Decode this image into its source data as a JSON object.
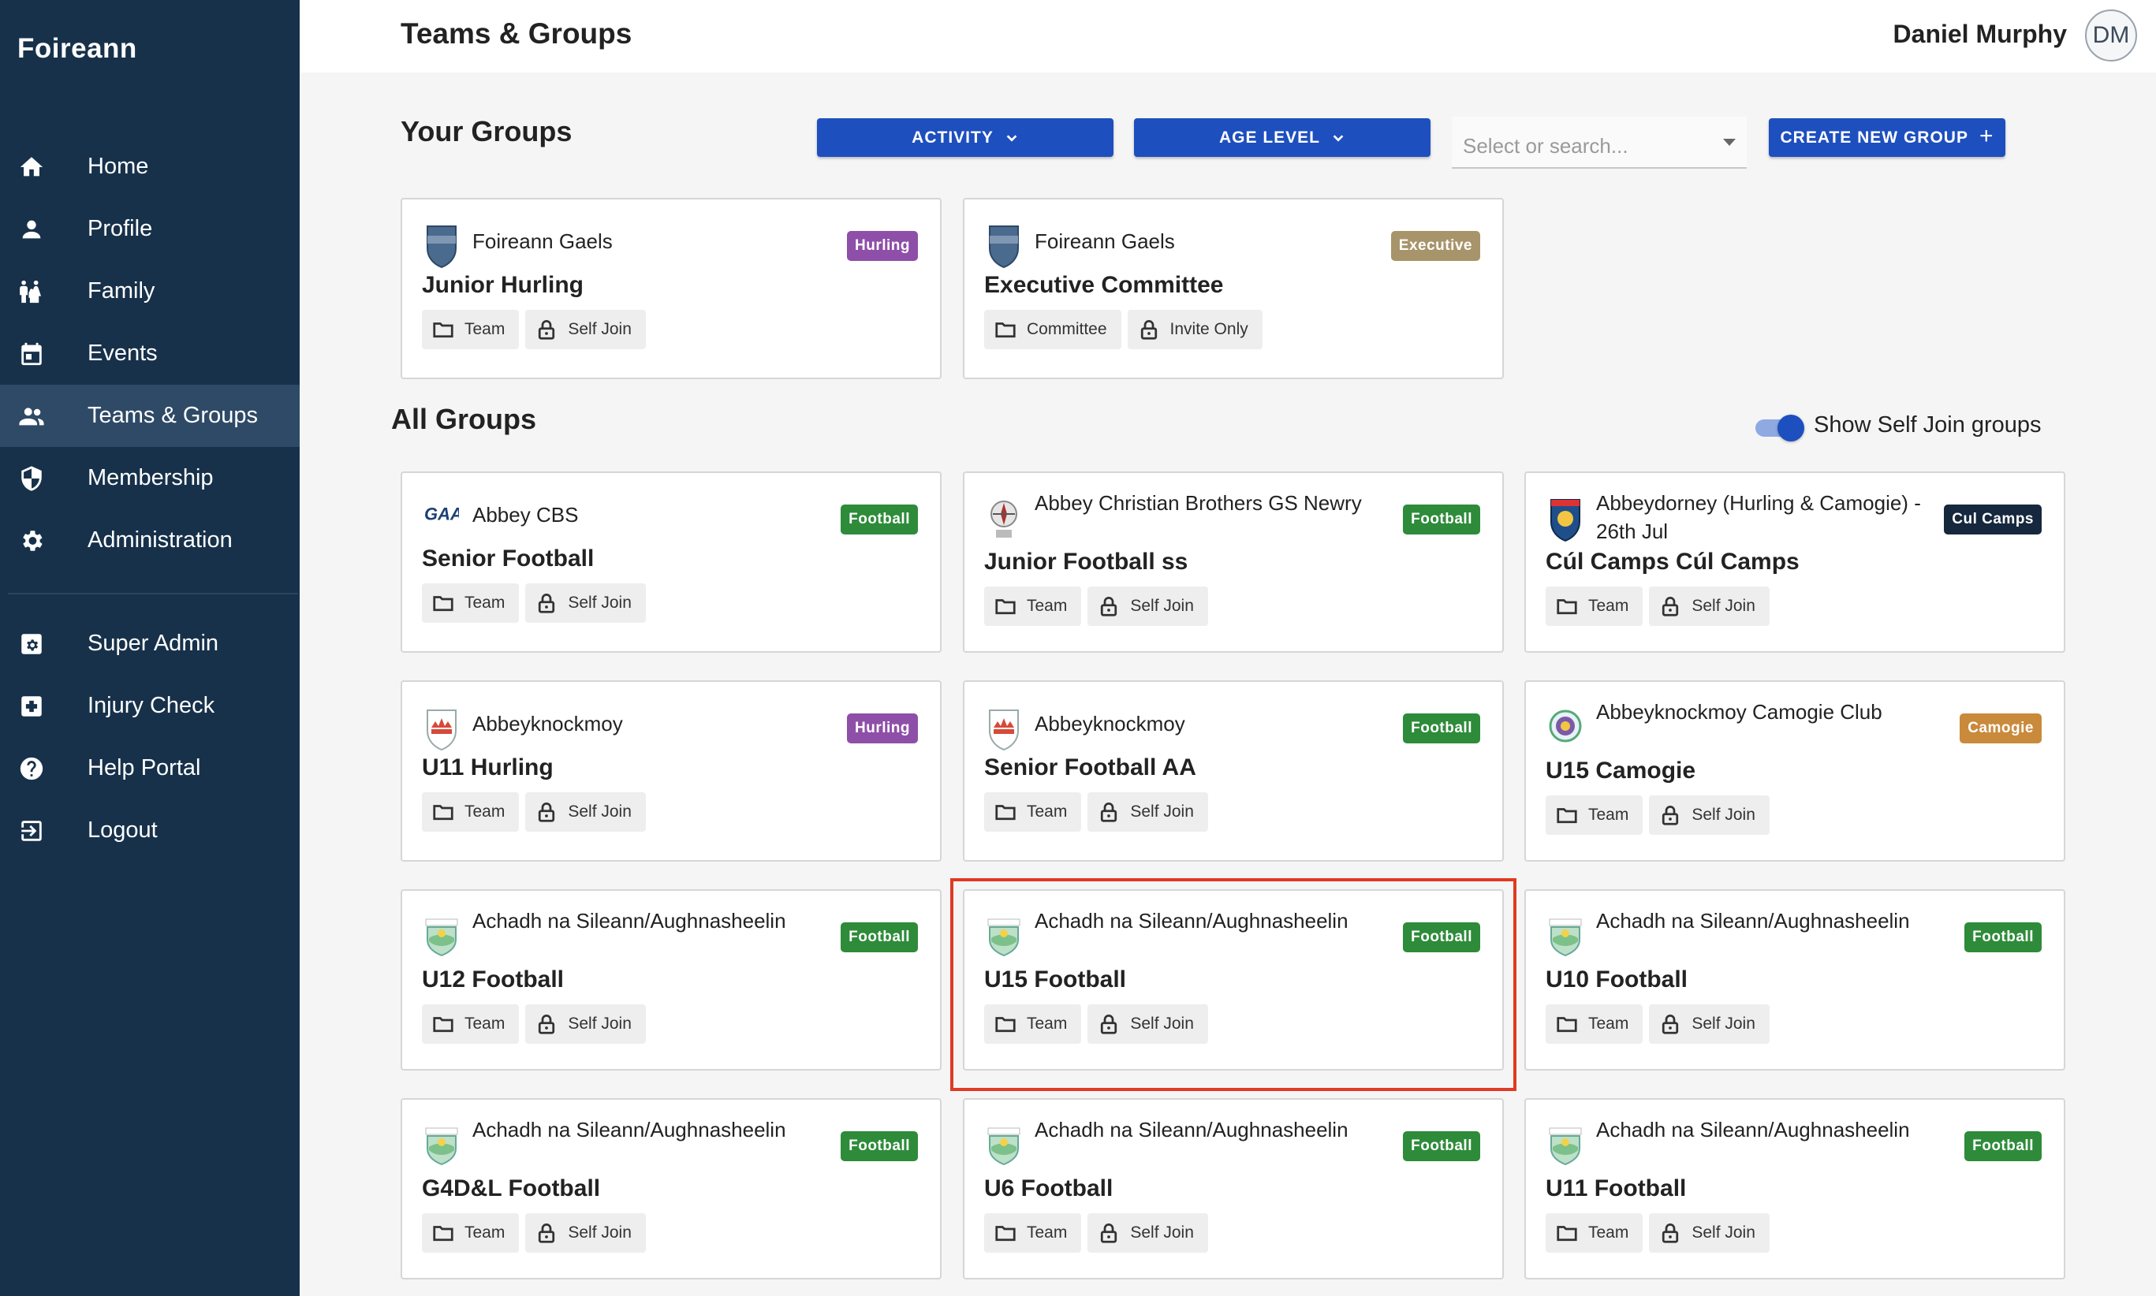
{
  "app": {
    "brand": "Foireann"
  },
  "sidebar": {
    "items": [
      {
        "label": "Home",
        "icon": "home-icon"
      },
      {
        "label": "Profile",
        "icon": "person-icon"
      },
      {
        "label": "Family",
        "icon": "family-icon"
      },
      {
        "label": "Events",
        "icon": "calendar-icon"
      },
      {
        "label": "Teams & Groups",
        "icon": "groups-icon",
        "active": true
      },
      {
        "label": "Membership",
        "icon": "shield-icon"
      },
      {
        "label": "Administration",
        "icon": "gear-icon"
      },
      {
        "label": "Super Admin",
        "icon": "admin-settings-icon"
      },
      {
        "label": "Injury Check",
        "icon": "medical-cross-icon"
      },
      {
        "label": "Help Portal",
        "icon": "help-icon"
      },
      {
        "label": "Logout",
        "icon": "logout-icon"
      }
    ]
  },
  "header": {
    "title": "Teams & Groups",
    "user_name": "Daniel Murphy",
    "avatar_initials": "DM"
  },
  "your_groups": {
    "title": "Your Groups",
    "filters": {
      "activity": "ACTIVITY",
      "age_level": "AGE LEVEL",
      "search_placeholder": "Select or search...",
      "create": "CREATE NEW GROUP",
      "create_icon": "+"
    },
    "cards": [
      {
        "org": "Foireann Gaels",
        "name": "Junior Hurling",
        "badge": "Hurling",
        "badge_color": "#8e4fa8",
        "chip1": "Team",
        "chip2": "Self Join",
        "logo": "foireann-gaels-crest"
      },
      {
        "org": "Foireann Gaels",
        "name": "Executive Committee",
        "badge": "Executive",
        "badge_color": "#a8946a",
        "chip1": "Committee",
        "chip2": "Invite Only",
        "logo": "foireann-gaels-crest"
      }
    ]
  },
  "all_groups": {
    "title": "All Groups",
    "toggle_label": "Show Self Join groups",
    "toggle_on": true,
    "cards": [
      {
        "org": "Abbey CBS",
        "name": "Senior Football",
        "badge": "Football",
        "badge_color": "#2e8b3a",
        "chip1": "Team",
        "chip2": "Self Join",
        "logo": "gaa-logo"
      },
      {
        "org": "Abbey Christian Brothers GS Newry",
        "name": "Junior Football ss",
        "badge": "Football",
        "badge_color": "#2e8b3a",
        "chip1": "Team",
        "chip2": "Self Join",
        "logo": "school-crest"
      },
      {
        "org": "Abbeydorney (Hurling & Camogie) - 26th Jul",
        "name": "Cúl Camps Cúl Camps",
        "badge": "Cul Camps",
        "badge_color": "#16283d",
        "chip1": "Team",
        "chip2": "Self Join",
        "logo": "cul-camps-crest"
      },
      {
        "org": "Abbeyknockmoy",
        "name": "U11 Hurling",
        "badge": "Hurling",
        "badge_color": "#8e4fa8",
        "chip1": "Team",
        "chip2": "Self Join",
        "logo": "abbeyknockmoy-crest"
      },
      {
        "org": "Abbeyknockmoy",
        "name": "Senior Football AA",
        "badge": "Football",
        "badge_color": "#2e8b3a",
        "chip1": "Team",
        "chip2": "Self Join",
        "logo": "abbeyknockmoy-crest"
      },
      {
        "org": "Abbeyknockmoy Camogie Club",
        "name": "U15 Camogie",
        "badge": "Camogie",
        "badge_color": "#c98a3c",
        "chip1": "Team",
        "chip2": "Self Join",
        "logo": "camogie-crest"
      },
      {
        "org": "Achadh na Sileann/Aughnasheelin",
        "name": "U12 Football",
        "badge": "Football",
        "badge_color": "#2e8b3a",
        "chip1": "Team",
        "chip2": "Self Join",
        "logo": "achadh-crest"
      },
      {
        "org": "Achadh na Sileann/Aughnasheelin",
        "name": "U15 Football",
        "badge": "Football",
        "badge_color": "#2e8b3a",
        "chip1": "Team",
        "chip2": "Self Join",
        "logo": "achadh-crest",
        "highlighted": true
      },
      {
        "org": "Achadh na Sileann/Aughnasheelin",
        "name": "U10 Football",
        "badge": "Football",
        "badge_color": "#2e8b3a",
        "chip1": "Team",
        "chip2": "Self Join",
        "logo": "achadh-crest"
      },
      {
        "org": "Achadh na Sileann/Aughnasheelin",
        "name": "G4D&L Football",
        "badge": "Football",
        "badge_color": "#2e8b3a",
        "chip1": "Team",
        "chip2": "Self Join",
        "logo": "achadh-crest"
      },
      {
        "org": "Achadh na Sileann/Aughnasheelin",
        "name": "U6 Football",
        "badge": "Football",
        "badge_color": "#2e8b3a",
        "chip1": "Team",
        "chip2": "Self Join",
        "logo": "achadh-crest"
      },
      {
        "org": "Achadh na Sileann/Aughnasheelin",
        "name": "U11 Football",
        "badge": "Football",
        "badge_color": "#2e8b3a",
        "chip1": "Team",
        "chip2": "Self Join",
        "logo": "achadh-crest"
      }
    ]
  }
}
